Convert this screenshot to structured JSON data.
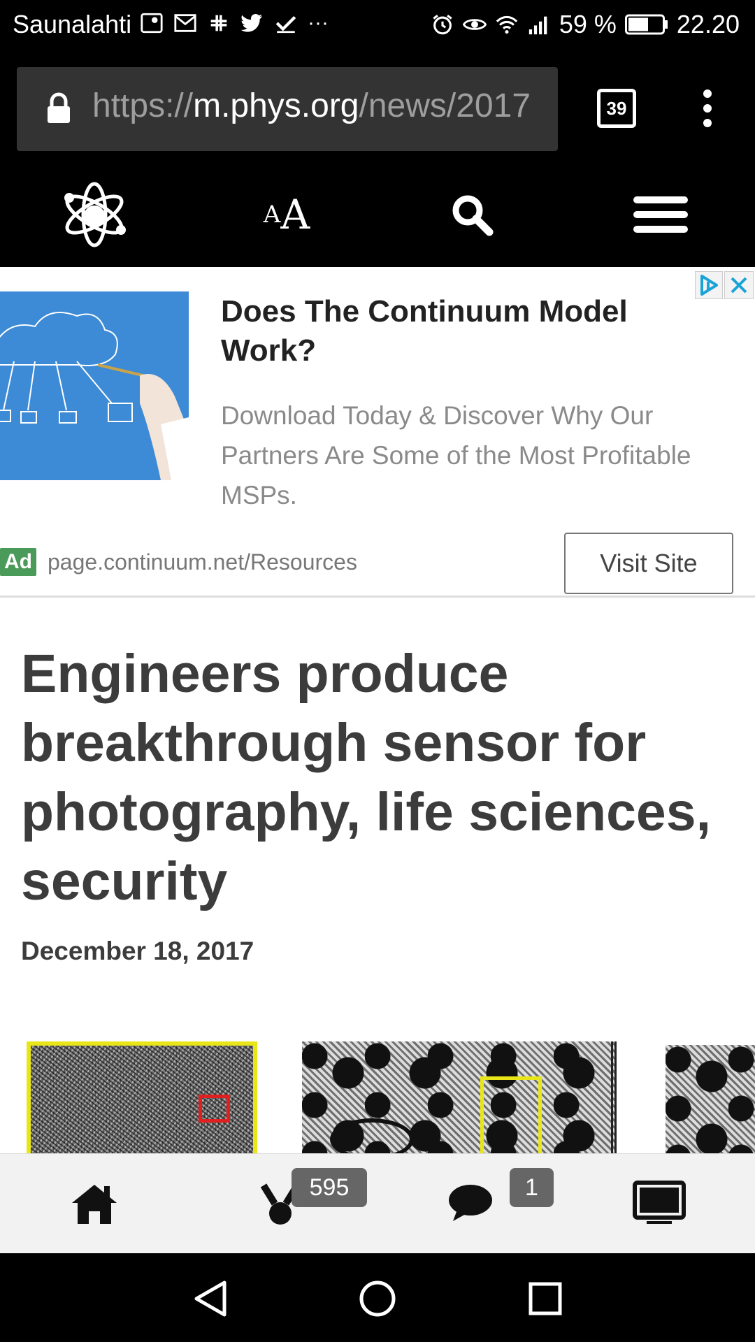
{
  "status_bar": {
    "carrier": "Saunalahti",
    "more_indicator": "···",
    "battery_percent": "59 %",
    "time": "22.20",
    "battery_level": 0.59
  },
  "browser": {
    "url_scheme": "https://",
    "url_host": "m.phys.org",
    "url_path": "/news/2017",
    "tab_count": "39"
  },
  "site_nav": {
    "text_size_small": "A",
    "text_size_big": "A"
  },
  "ad": {
    "title": "Does The Continuum Model Work?",
    "description": "Download Today & Discover Why Our Partners Are Some of the Most Profitable MSPs.",
    "label": "Ad",
    "url": "page.continuum.net/Resources",
    "cta": "Visit Site"
  },
  "article": {
    "headline": "Engineers produce breakthrough sensor for photography, life sciences, security",
    "date": "December 18, 2017"
  },
  "app_bar": {
    "badge_count_1": "595",
    "badge_count_2": "1"
  },
  "colors": {
    "ad_label_bg": "#4a9a5a",
    "headline_text": "#3c3c3c",
    "adchoices_blue": "#1aa3d6"
  }
}
